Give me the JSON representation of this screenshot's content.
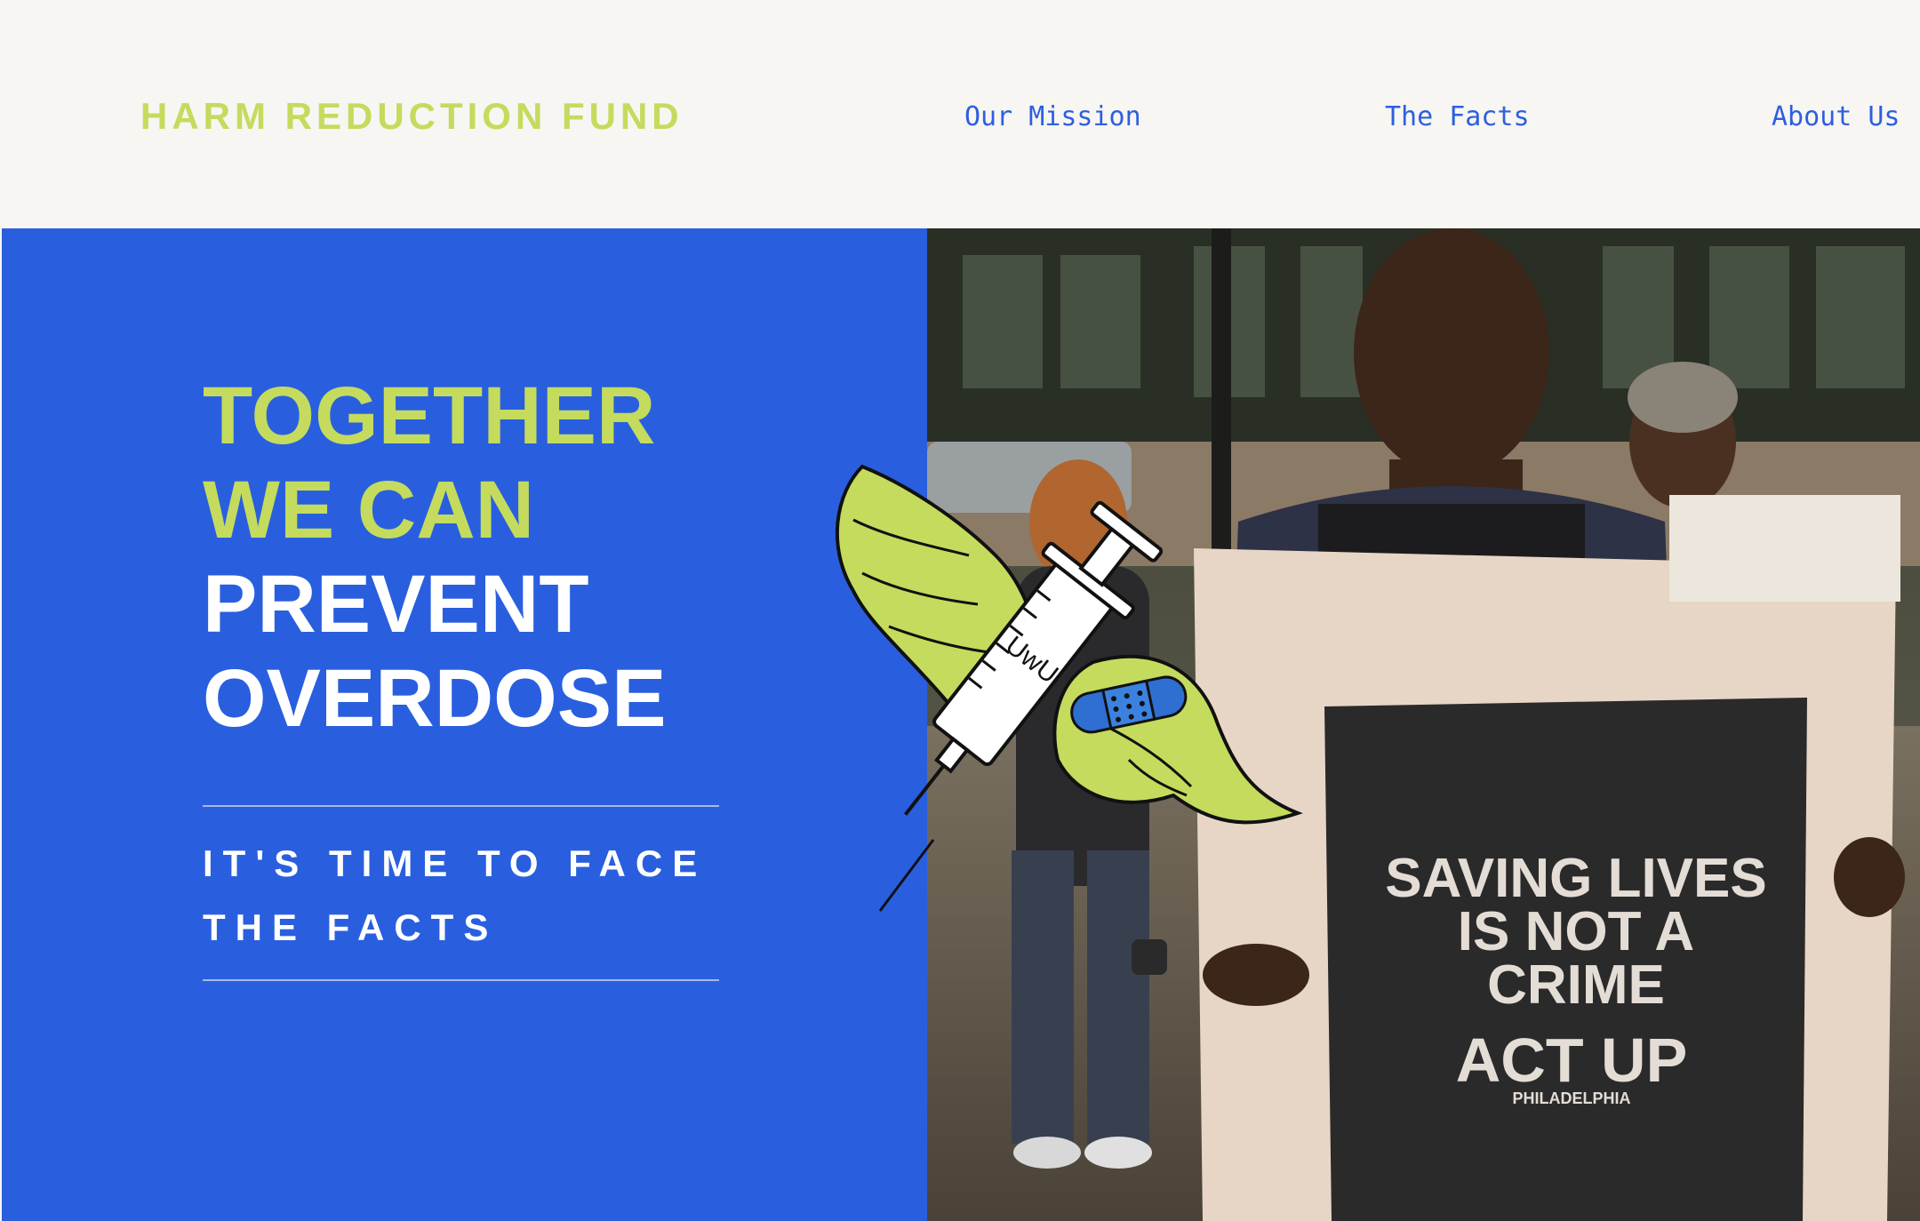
{
  "header": {
    "brand": "HARM REDUCTION FUND",
    "nav": [
      {
        "label": "Our Mission"
      },
      {
        "label": "The Facts"
      },
      {
        "label": "About Us"
      }
    ]
  },
  "hero": {
    "headline_lines": [
      "TOGETHER",
      "WE CAN",
      "PREVENT",
      "OVERDOSE"
    ],
    "subheading": "IT'S TIME TO FACE THE FACTS",
    "photo": {
      "sign_text": [
        "SAVING LIVES",
        "IS NOT A",
        "CRIME"
      ],
      "sign_logo": "ACT UP",
      "sign_logo_sub": "PHILADELPHIA"
    },
    "mark_face": "UwU"
  },
  "colors": {
    "accent_green": "#c4db5d",
    "hero_blue": "#295fdf",
    "nav_blue": "#2d5fe0",
    "background": "#f7f6f2"
  },
  "icons": [
    "winged-syringe-icon",
    "bandage-icon"
  ]
}
